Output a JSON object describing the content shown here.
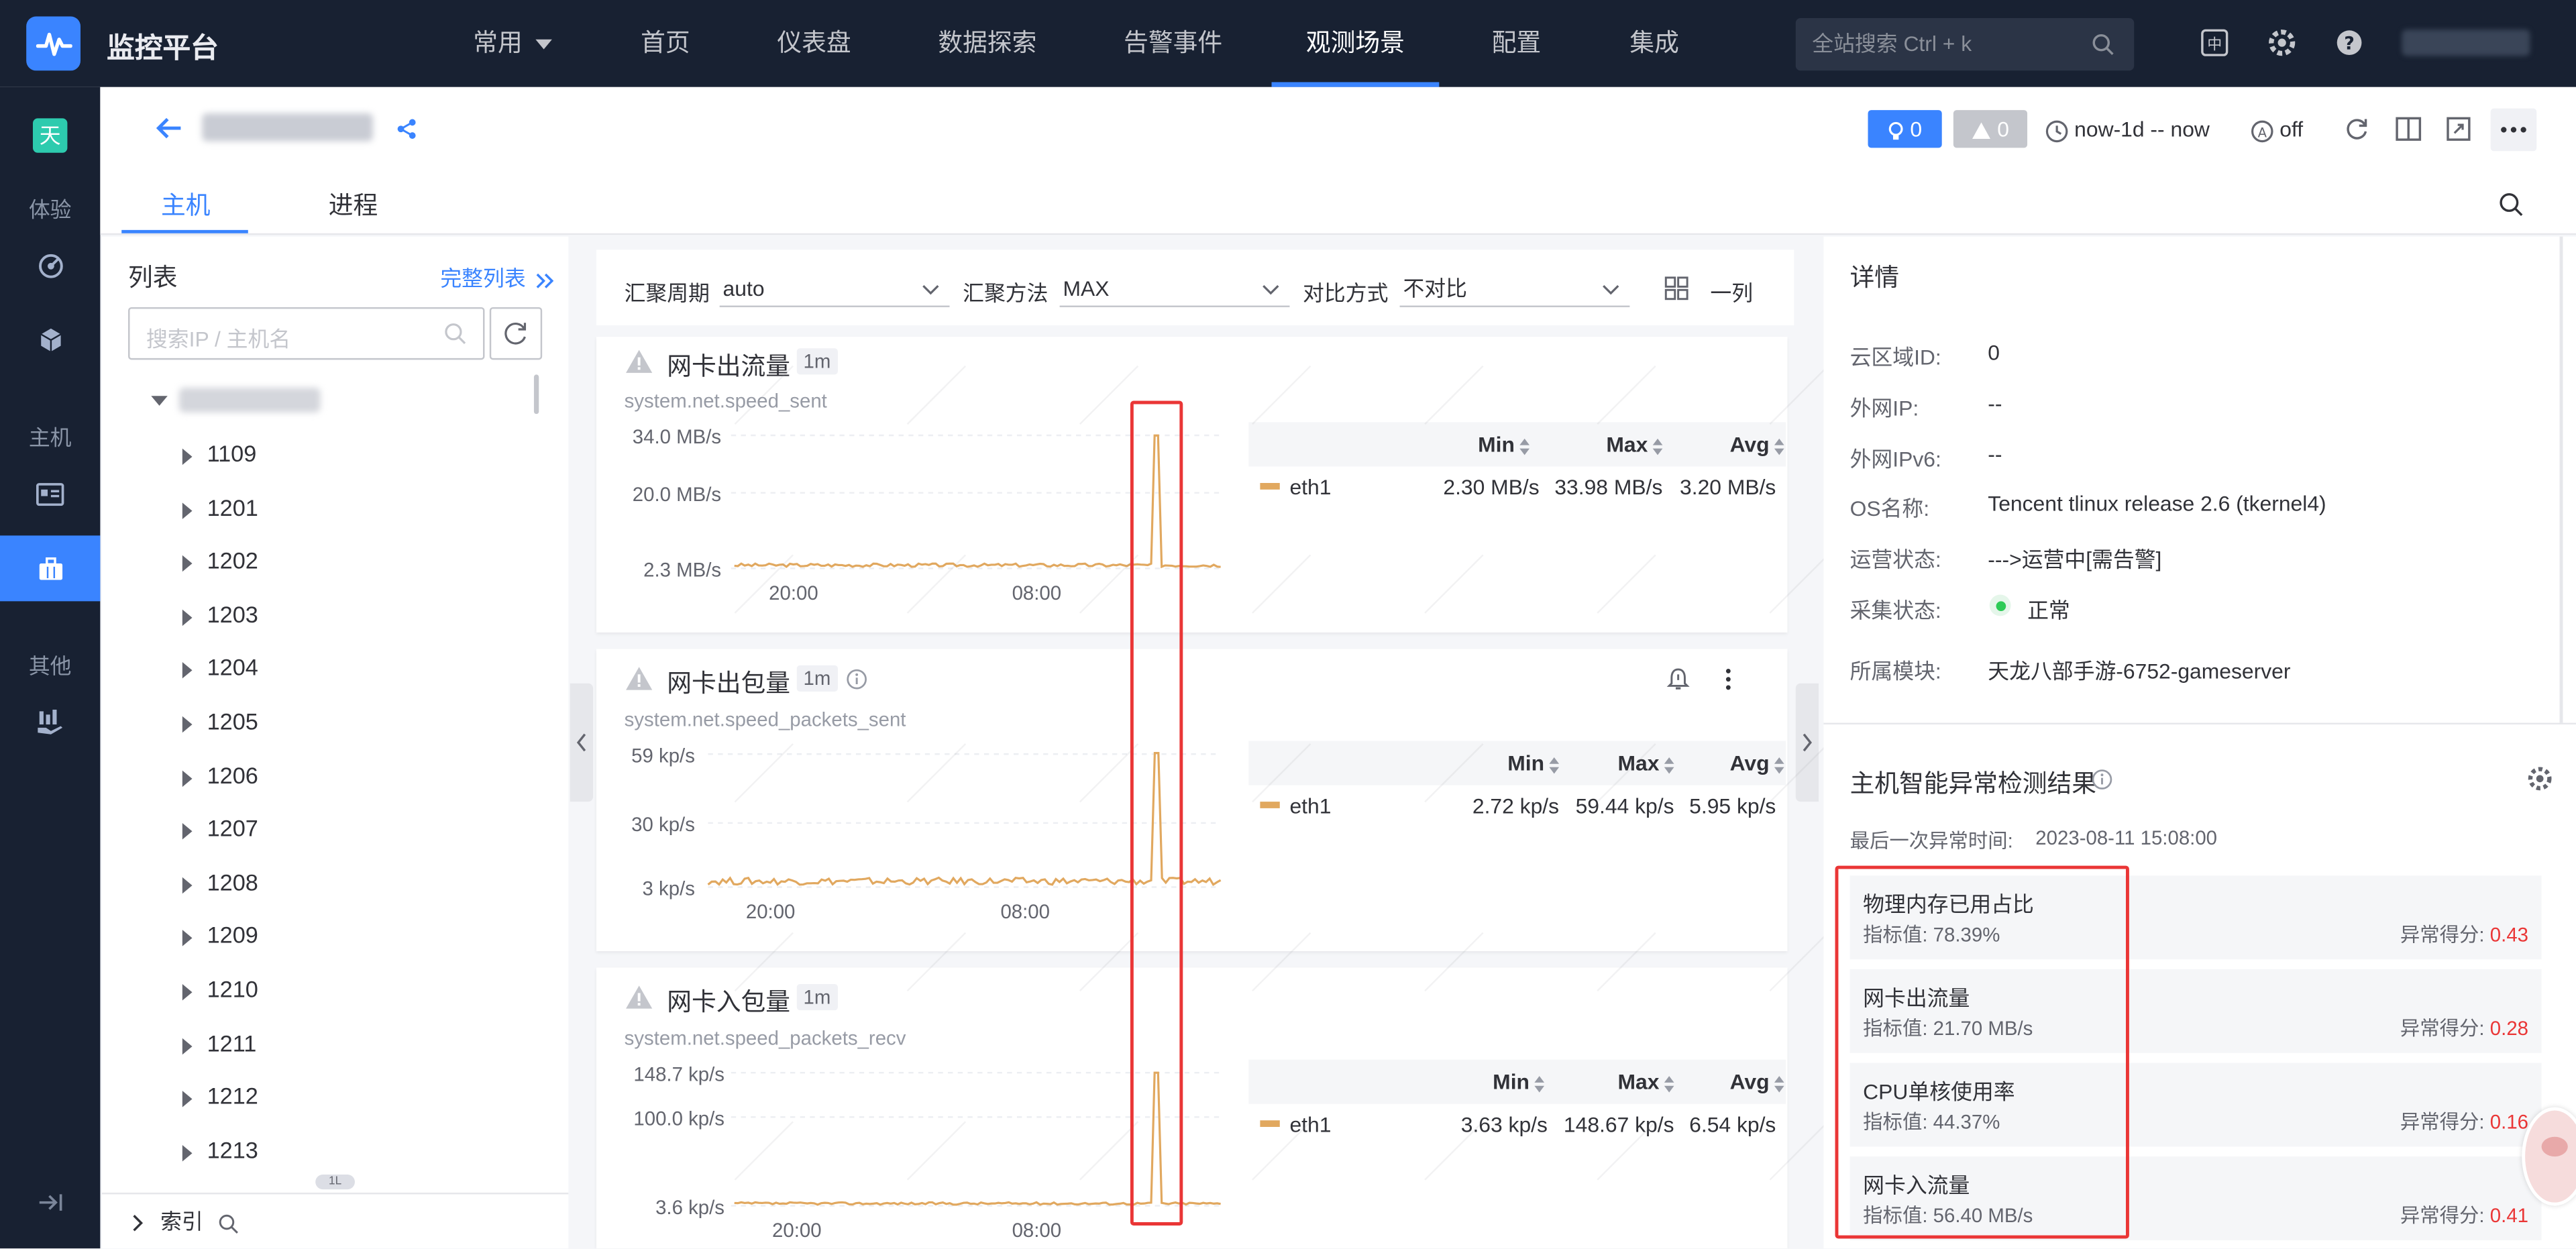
{
  "topbar": {
    "app_name": "监控平台",
    "nav": [
      {
        "label": "常用"
      },
      {
        "label": "首页"
      },
      {
        "label": "仪表盘"
      },
      {
        "label": "数据探索"
      },
      {
        "label": "告警事件"
      },
      {
        "label": "观测场景"
      },
      {
        "label": "配置"
      },
      {
        "label": "集成"
      }
    ],
    "active_nav": "观测场景",
    "search_placeholder": "全站搜索 Ctrl + k"
  },
  "leftnav": {
    "badge": "天",
    "sections": [
      "体验",
      "主机",
      "其他"
    ]
  },
  "header": {
    "alert_count": "0",
    "warn_count": "0",
    "time_range": "now-1d -- now",
    "refresh_state": "off",
    "tabs": [
      "主机",
      "进程"
    ]
  },
  "list_panel": {
    "title": "列表",
    "full_list_link": "完整列表",
    "search_placeholder": "搜索IP / 主机名",
    "tree_items": [
      "1109",
      "1201",
      "1202",
      "1203",
      "1204",
      "1205",
      "1206",
      "1207",
      "1208",
      "1209",
      "1210",
      "1211",
      "1212",
      "1213"
    ],
    "index_label": "索引",
    "scroll_hint": "1L"
  },
  "filters": {
    "period_label": "汇聚周期",
    "period_value": "auto",
    "method_label": "汇聚方法",
    "method_value": "MAX",
    "compare_label": "对比方式",
    "compare_value": "不对比",
    "layout_label": "一列"
  },
  "charts": [
    {
      "title": "网卡出流量",
      "interval": "1m",
      "metric": "system.net.speed_sent",
      "y_ticks": [
        "34.0 MB/s",
        "20.0 MB/s",
        "2.3 MB/s"
      ],
      "x_ticks": [
        "20:00",
        "08:00"
      ],
      "legend_headers": [
        "Min",
        "Max",
        "Avg"
      ],
      "legend_row": {
        "name": "eth1",
        "min": "2.30 MB/s",
        "max": "33.98 MB/s",
        "avg": "3.20 MB/s"
      }
    },
    {
      "title": "网卡出包量",
      "interval": "1m",
      "metric": "system.net.speed_packets_sent",
      "y_ticks": [
        "59 kp/s",
        "30 kp/s",
        "3 kp/s"
      ],
      "x_ticks": [
        "20:00",
        "08:00"
      ],
      "legend_headers": [
        "Min",
        "Max",
        "Avg"
      ],
      "legend_row": {
        "name": "eth1",
        "min": "2.72 kp/s",
        "max": "59.44 kp/s",
        "avg": "5.95 kp/s"
      }
    },
    {
      "title": "网卡入包量",
      "interval": "1m",
      "metric": "system.net.speed_packets_recv",
      "y_ticks": [
        "148.7 kp/s",
        "100.0 kp/s",
        "3.6 kp/s"
      ],
      "x_ticks": [
        "20:00",
        "08:00"
      ],
      "legend_headers": [
        "Min",
        "Max",
        "Avg"
      ],
      "legend_row": {
        "name": "eth1",
        "min": "3.63 kp/s",
        "max": "148.67 kp/s",
        "avg": "6.54 kp/s"
      }
    }
  ],
  "chart_data": [
    {
      "type": "line",
      "title": "网卡出流量",
      "ylabel": "",
      "x": [
        "20:00",
        "08:00"
      ],
      "ylim": [
        2.3,
        34.0
      ],
      "series": [
        {
          "name": "eth1",
          "min": 2.3,
          "max": 33.98,
          "avg": 3.2
        }
      ]
    },
    {
      "type": "line",
      "title": "网卡出包量",
      "ylabel": "",
      "x": [
        "20:00",
        "08:00"
      ],
      "ylim": [
        3,
        59
      ],
      "series": [
        {
          "name": "eth1",
          "min": 2.72,
          "max": 59.44,
          "avg": 5.95
        }
      ]
    },
    {
      "type": "line",
      "title": "网卡入包量",
      "ylabel": "",
      "x": [
        "20:00",
        "08:00"
      ],
      "ylim": [
        3.6,
        148.7
      ],
      "series": [
        {
          "name": "eth1",
          "min": 3.63,
          "max": 148.67,
          "avg": 6.54
        }
      ]
    }
  ],
  "details": {
    "title": "详情",
    "rows": [
      {
        "label": "云区域ID:",
        "value": "0"
      },
      {
        "label": "外网IP:",
        "value": "--"
      },
      {
        "label": "外网IPv6:",
        "value": "--"
      },
      {
        "label": "OS名称:",
        "value": "Tencent tlinux release 2.6 (tkernel4)"
      },
      {
        "label": "运营状态:",
        "value": "--->运营中[需告警]"
      },
      {
        "label": "采集状态:",
        "value": "正常"
      },
      {
        "label": "所属模块:",
        "value": "天龙八部手游-6752-gameserver"
      }
    ]
  },
  "anomaly": {
    "title": "主机智能异常检测结果",
    "last_time_label": "最后一次异常时间:",
    "last_time": "2023-08-11 15:08:00",
    "items": [
      {
        "name": "物理内存已用占比",
        "value": "指标值: 78.39%",
        "score_label": "异常得分:",
        "score": "0.43"
      },
      {
        "name": "网卡出流量",
        "value": "指标值: 21.70 MB/s",
        "score_label": "异常得分:",
        "score": "0.28"
      },
      {
        "name": "CPU单核使用率",
        "value": "指标值: 44.37%",
        "score_label": "异常得分:",
        "score": "0.16"
      },
      {
        "name": "网卡入流量",
        "value": "指标值: 56.40 MB/s",
        "score_label": "异常得分:",
        "score": "0.41"
      }
    ]
  },
  "colors": {
    "accent": "#3a84ff",
    "nav_bg": "#182132",
    "series": "#e1a85f",
    "highlight_box": "#ea3636",
    "status_ok": "#2dcb56"
  }
}
